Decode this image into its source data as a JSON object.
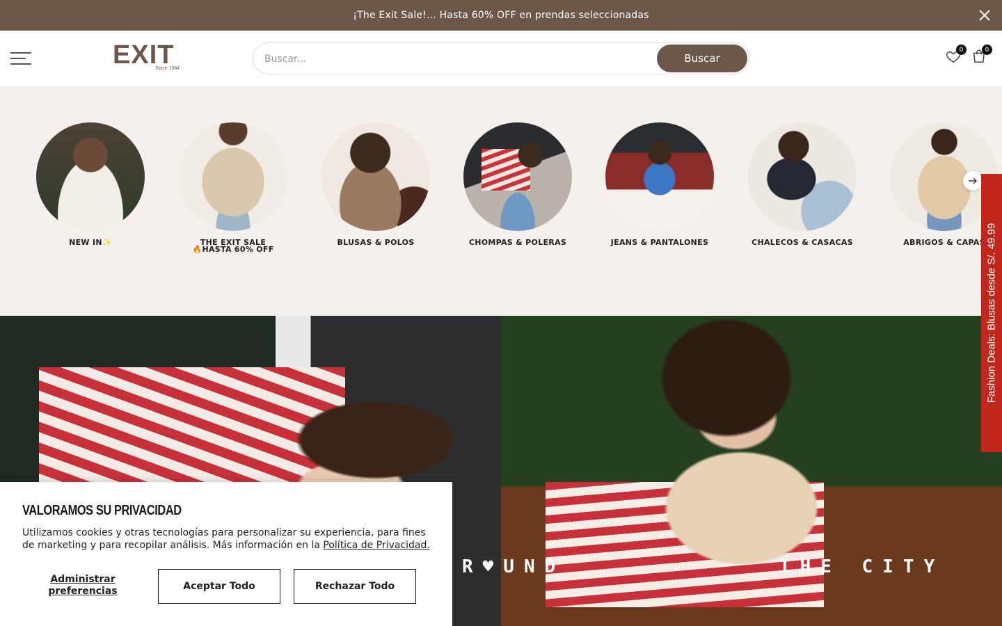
{
  "announcement": {
    "text": "¡The Exit Sale!... Hasta 60% OFF en prendas seleccionadas"
  },
  "header": {
    "logo_text": "EXIT",
    "logo_since": "Since 1984",
    "search_placeholder": "Buscar...",
    "search_button": "Buscar",
    "wishlist_count": "0",
    "cart_count": "0"
  },
  "categories": [
    {
      "label": "NEW IN✨",
      "icon": "new-in-photo"
    },
    {
      "label": "THE EXIT SALE\n🔥HASTA 60% OFF",
      "line1": "THE EXIT SALE",
      "line2": "🔥HASTA 60% OFF",
      "icon": "sale-photo"
    },
    {
      "label": "BLUSAS & POLOS",
      "icon": "blusas-photo"
    },
    {
      "label": "CHOMPAS & POLERAS",
      "icon": "chompas-photo"
    },
    {
      "label": "JEANS & PANTALONES",
      "icon": "jeans-photo"
    },
    {
      "label": "CHALECOS & CASACAS",
      "icon": "chalecos-photo"
    },
    {
      "label": "ABRIGOS & CAPAS",
      "icon": "abrigos-photo"
    }
  ],
  "hero": {
    "left_text": "R♥UND",
    "right_text": "THE CITY"
  },
  "side_tab": {
    "text": "Fashion Deals: Blusas desde S/. 49.99"
  },
  "cookie": {
    "title": "VALORAMOS SU PRIVACIDAD",
    "body": "Utilizamos cookies y otras tecnologías para personalizar su experiencia, para fines de marketing y para recopilar análisis. Más información en la",
    "link": "Política de Privacidad.",
    "manage": "Administrar preferencias",
    "accept": "Aceptar Todo",
    "reject": "Rechazar Todo"
  },
  "colors": {
    "brand_brown": "#6d5749",
    "side_tab_red": "#c1271a",
    "strip_bg": "#f5f0ec"
  }
}
